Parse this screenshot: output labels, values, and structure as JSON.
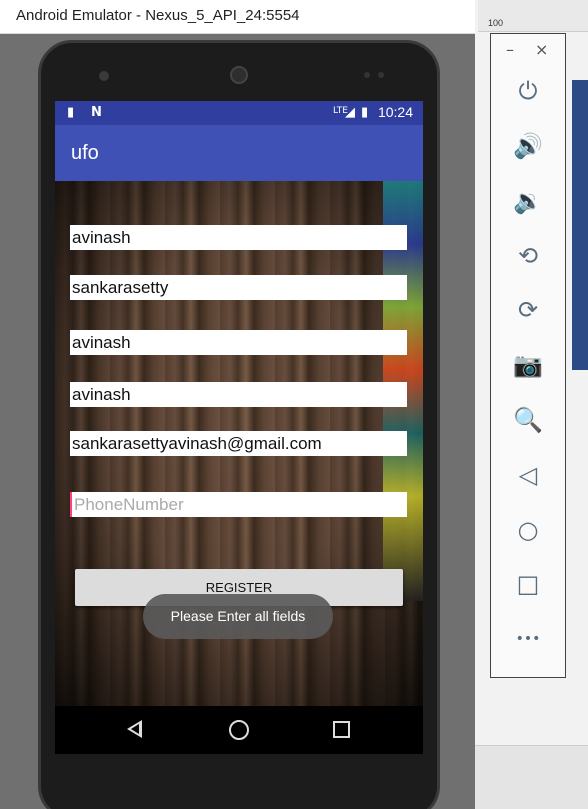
{
  "window": {
    "title": "Android Emulator - Nexus_5_API_24:5554"
  },
  "statusbar": {
    "time": "10:24",
    "network_label": "LTE",
    "icons": [
      "sd-card-icon",
      "n-icon",
      "signal-icon",
      "battery-icon"
    ]
  },
  "app": {
    "title": "ufo"
  },
  "form": {
    "fields": [
      {
        "value": "avinash",
        "placeholder": ""
      },
      {
        "value": "sankarasetty",
        "placeholder": ""
      },
      {
        "value": "avinash",
        "placeholder": ""
      },
      {
        "value": "avinash",
        "placeholder": ""
      },
      {
        "value": "sankarasettyavinash@gmail.com",
        "placeholder": ""
      },
      {
        "value": "",
        "placeholder": "PhoneNumber"
      }
    ],
    "register_label": "REGISTER"
  },
  "toast": {
    "message": "Please Enter all fields"
  },
  "ide": {
    "ruler_label": "100"
  },
  "toolbar": {
    "minimize_label": "–",
    "close_label": "×",
    "buttons": [
      {
        "name": "power-icon",
        "glyph": "⏻"
      },
      {
        "name": "volume-up-icon",
        "glyph": "🔊"
      },
      {
        "name": "volume-down-icon",
        "glyph": "🔉"
      },
      {
        "name": "rotate-left-icon",
        "glyph": "⟲"
      },
      {
        "name": "rotate-right-icon",
        "glyph": "⟳"
      },
      {
        "name": "camera-icon",
        "glyph": "📷"
      },
      {
        "name": "zoom-icon",
        "glyph": "🔍"
      },
      {
        "name": "back-icon",
        "glyph": "◁"
      },
      {
        "name": "home-icon",
        "glyph": "○"
      },
      {
        "name": "overview-icon",
        "glyph": "□"
      },
      {
        "name": "more-icon",
        "glyph": "•••"
      }
    ]
  },
  "colors": {
    "status_bar": "#303f9f",
    "action_bar": "#3f51b5",
    "accent": "#ff4081"
  }
}
